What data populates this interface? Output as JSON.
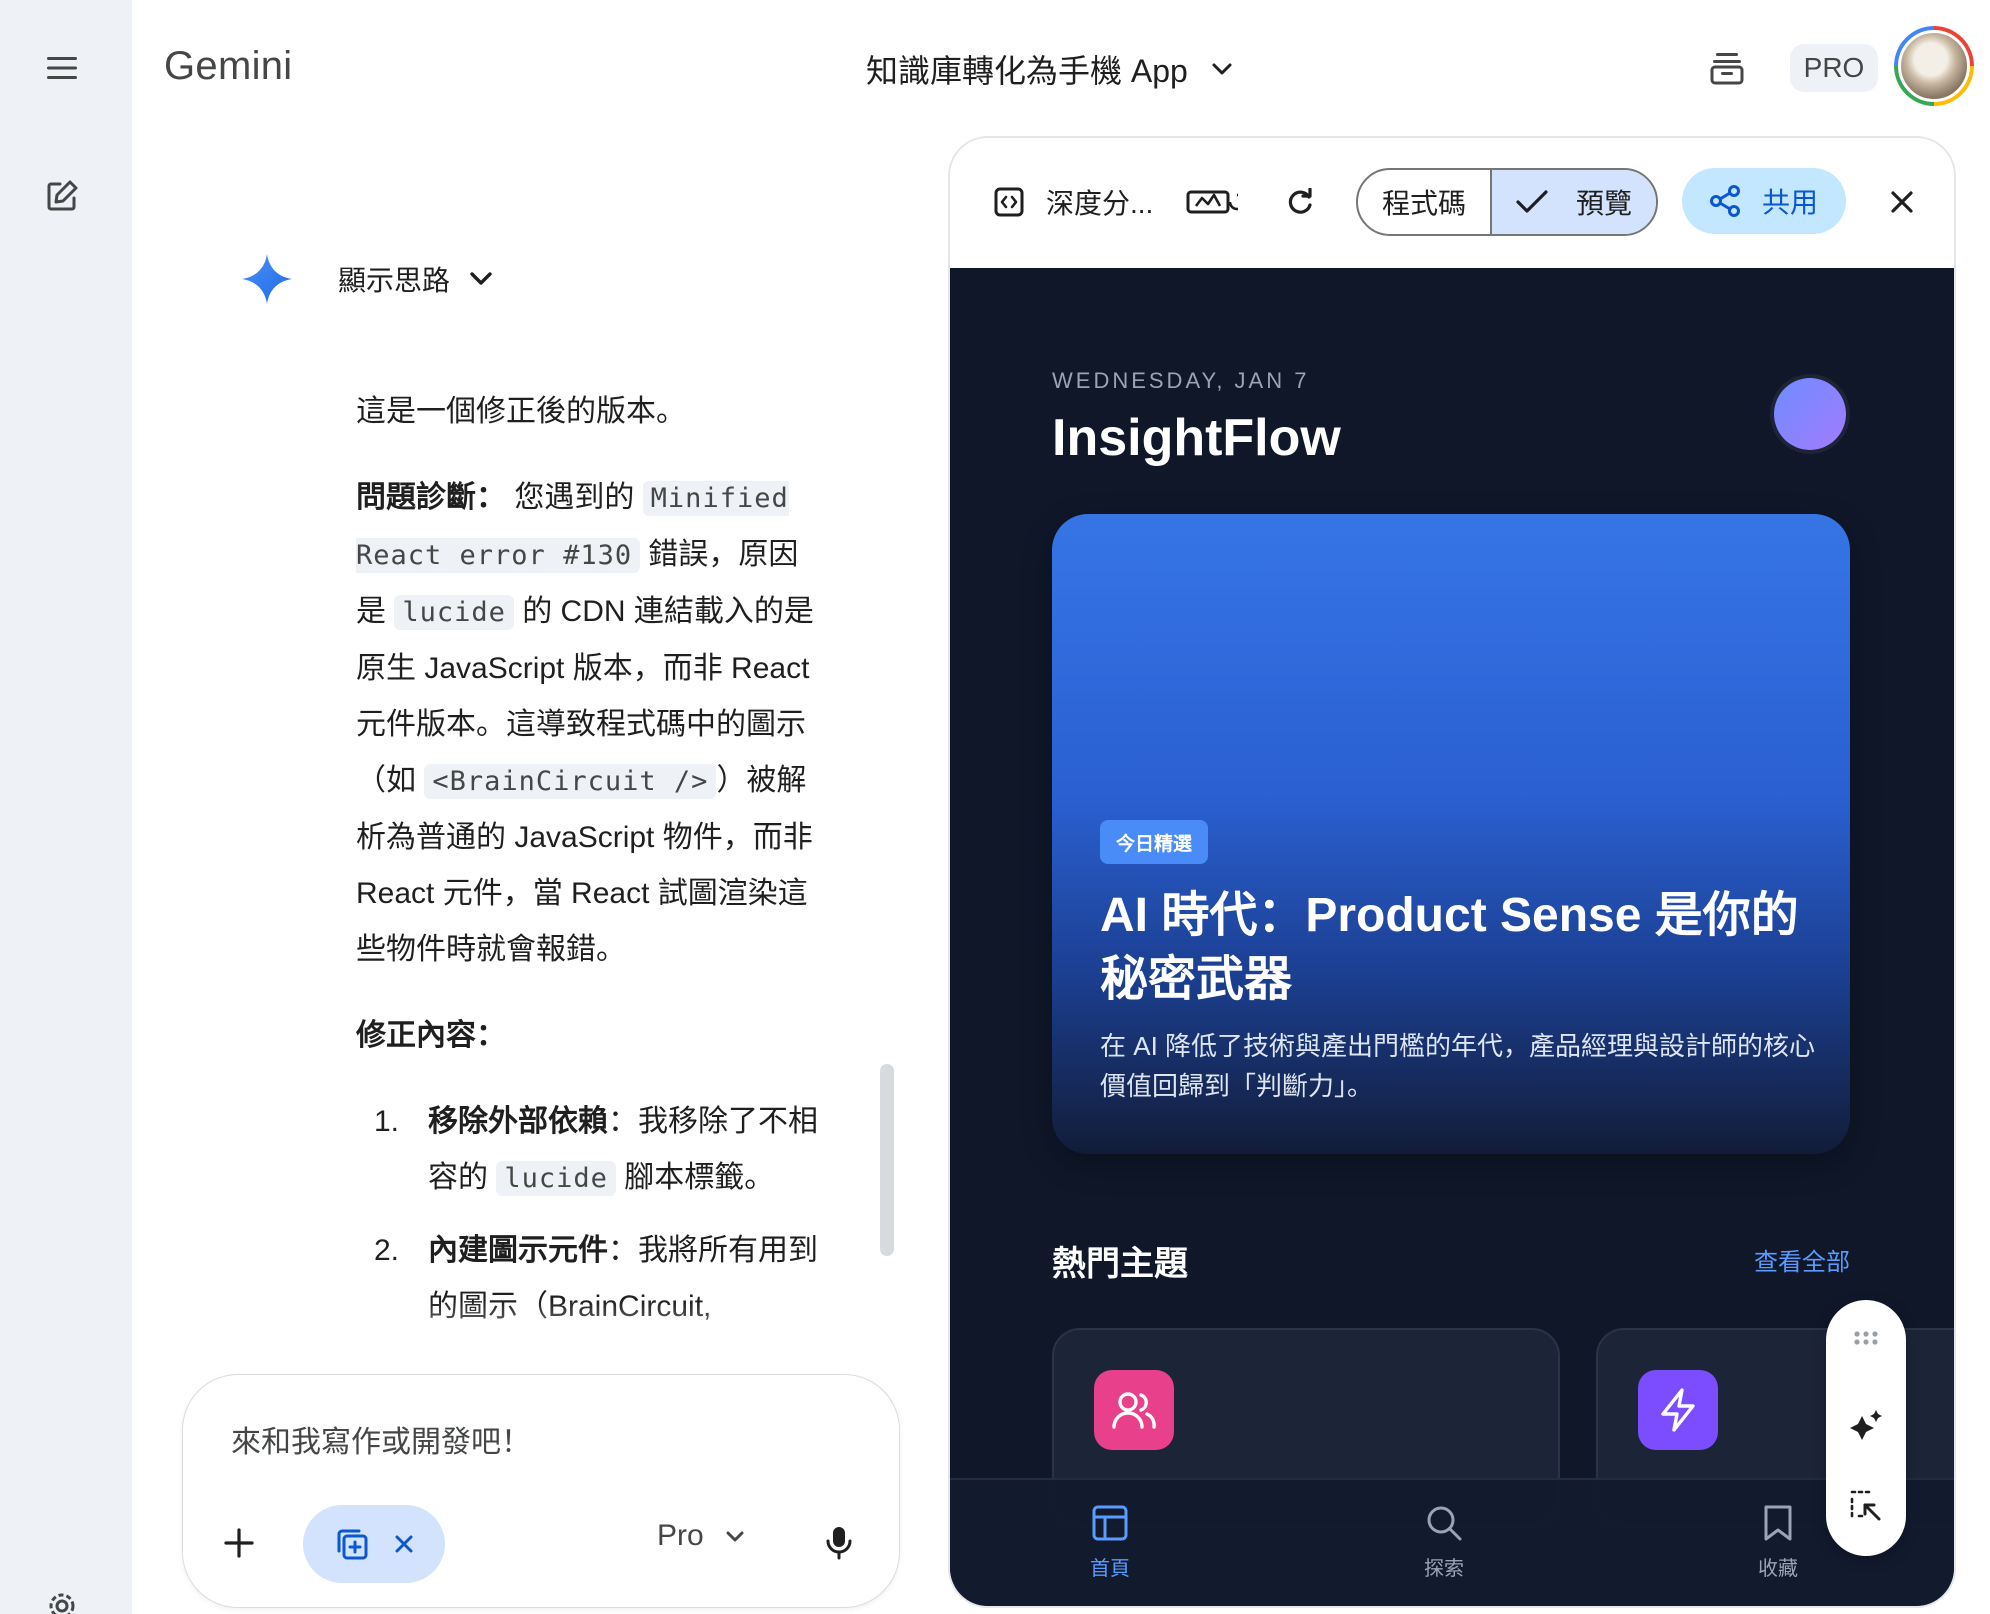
{
  "app": {
    "title": "Gemini"
  },
  "header": {
    "conversation_title": "知識庫轉化為手機 App",
    "pro_badge": "PRO"
  },
  "thinking": {
    "label": "顯示思路"
  },
  "message": {
    "intro": "這是一個修正後的版本。",
    "diag_label": "問題診斷：",
    "diag_1": " 您遇到的 ",
    "code_error": "Minified React error #130",
    "diag_2": " 錯誤，原因是 ",
    "code_lucide": "lucide",
    "diag_3": " 的 CDN 連結載入的是原生 JavaScript 版本，而非 React 元件版本。這導致程式碼中的圖示（如 ",
    "code_brain": "<BrainCircuit />",
    "diag_4": "）被解析為普通的 JavaScript 物件，而非 React 元件，當 React 試圖渲染這些物件時就會報錯。",
    "fix_heading": "修正內容：",
    "fixes": [
      {
        "num": "1.",
        "label": "移除外部依賴",
        "text_1": "：我移除了不相容的 ",
        "code": "lucide",
        "text_2": " 腳本標籤。"
      },
      {
        "num": "2.",
        "label": "內建圖示元件",
        "text_1": "：我將所有用到的圖示（BrainCircuit,",
        "code": "",
        "text_2": ""
      }
    ]
  },
  "input": {
    "placeholder": "來和我寫作或開發吧！",
    "model": "Pro"
  },
  "panel": {
    "doc_title": "深度分...",
    "tab_code": "程式碼",
    "tab_preview": "預覽",
    "share": "共用"
  },
  "preview": {
    "date": "WEDNESDAY, JAN 7",
    "brand": "InsightFlow",
    "hero_badge": "今日精選",
    "hero_title": "AI 時代：Product Sense 是你的秘密武器",
    "hero_desc": "在 AI 降低了技術與產出門檻的年代，產品經理與設計師的核心價值回歸到「判斷力」。",
    "section_title": "熱門主題",
    "see_all": "查看全部",
    "tabs": [
      {
        "label": "首頁",
        "icon": "layout-icon",
        "active": true
      },
      {
        "label": "探索",
        "icon": "search-icon",
        "active": false
      },
      {
        "label": "收藏",
        "icon": "bookmark-icon",
        "active": false
      }
    ],
    "colors": {
      "bg": "#0f1729",
      "accent": "#4a8cf7",
      "topic_pink": "#e8408a",
      "topic_purple": "#7c4dff"
    }
  }
}
